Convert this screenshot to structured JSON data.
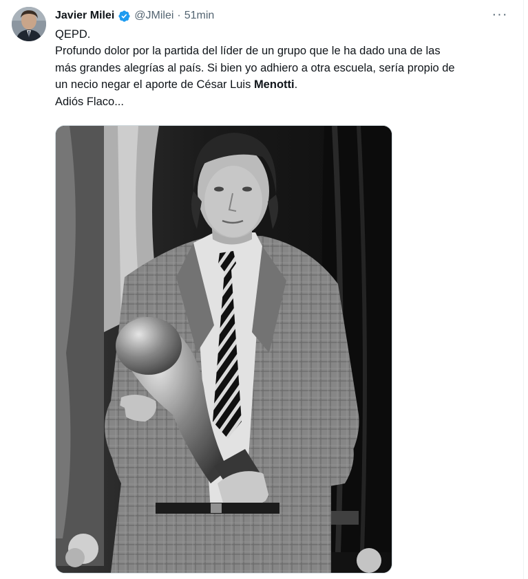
{
  "tweet": {
    "author": {
      "display_name": "Javier Milei",
      "handle": "@JMilei",
      "verified_icon": "verified-badge-icon",
      "avatar_icon": "avatar"
    },
    "separator": "·",
    "timestamp": "51min",
    "more_label": "···",
    "text": {
      "line1": "QEPD.",
      "line2": "Profundo dolor por la partida del líder de un grupo que le ha dado una de las",
      "line3": "más grandes alegrías al país. Si bien yo adhiero a otra escuela, sería propio de",
      "line4_pre": "un necio negar el aporte de César Luis ",
      "line4_bold": "Menotti",
      "line4_post": ".",
      "line5": "Adiós Flaco..."
    },
    "media": {
      "kind": "photo",
      "icon": "photo-menotti-with-world-cup-trophy"
    }
  },
  "colors": {
    "text": "#0f1419",
    "secondary": "#536471",
    "verified": "#1d9bf0",
    "border": "#cfd9de"
  }
}
